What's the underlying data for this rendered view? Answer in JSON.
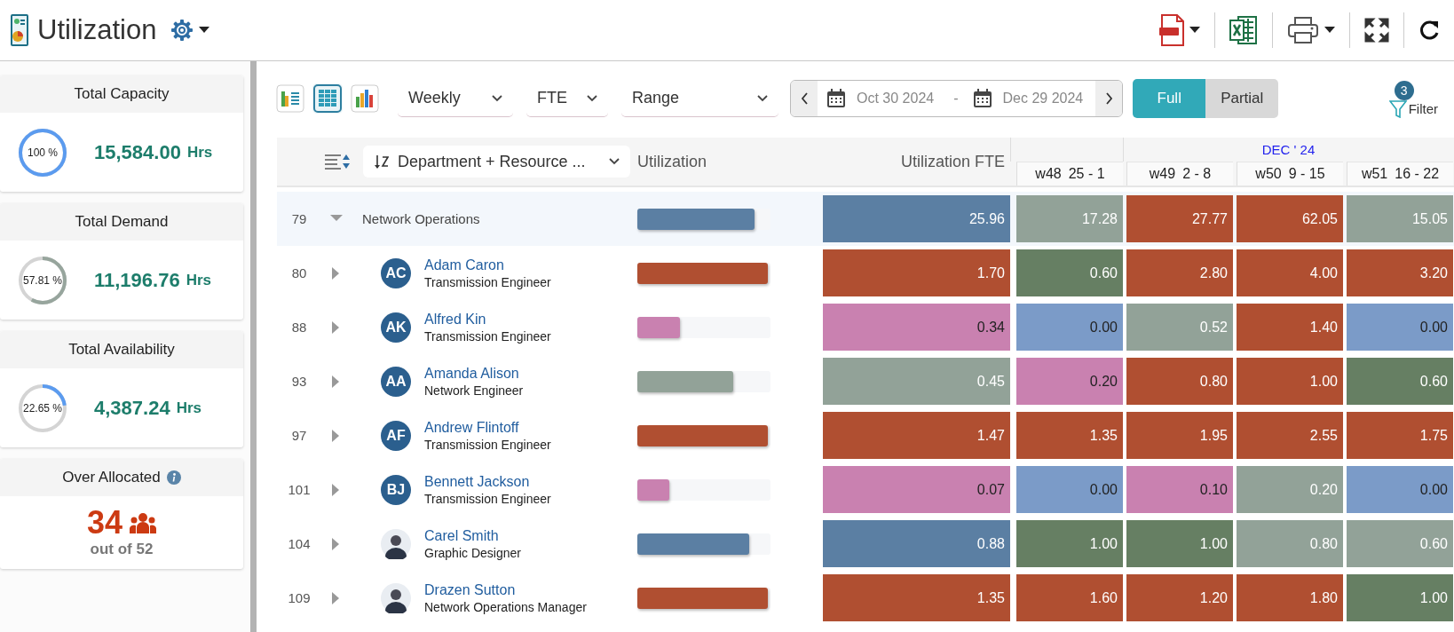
{
  "header": {
    "title": "Utilization"
  },
  "summary_cards": [
    {
      "kind": "ring",
      "title": "Total Capacity",
      "percent": "100 %",
      "level": 1,
      "color": "#5b9bef",
      "value": "15,584.00",
      "unit": "Hrs"
    },
    {
      "kind": "ring",
      "title": "Total Demand",
      "percent": "57.81 %",
      "level": 0.5781,
      "color": "#97a59d",
      "value": "11,196.76",
      "unit": "Hrs"
    },
    {
      "kind": "ring",
      "title": "Total Availability",
      "percent": "22.65 %",
      "level": 0.2265,
      "color": "#5b9bef",
      "value": "4,387.24",
      "unit": "Hrs"
    },
    {
      "kind": "count",
      "title": "Over Allocated",
      "value": "34",
      "subtext": "out of 52"
    }
  ],
  "toolbar": {
    "views": [
      {
        "kind": "stacked-list",
        "selected": false
      },
      {
        "kind": "table",
        "selected": true
      },
      {
        "kind": "bar-chart",
        "selected": false
      }
    ],
    "dropdowns": [
      "Weekly",
      "FTE",
      "Range"
    ],
    "date_from": "Oct 30 2024",
    "date_separator": "-",
    "date_to": "Dec 29 2024",
    "modes": [
      {
        "label": "Full",
        "selected": true
      },
      {
        "label": "Partial",
        "selected": false
      }
    ],
    "filter": {
      "label": "Filter",
      "badge": "3"
    }
  },
  "grid": {
    "group_by": "Department + Resource ...",
    "columns": [
      "Utilization",
      "Utilization FTE"
    ],
    "months": [
      {
        "weeks": [
          {
            "week": "w48",
            "range": "25 - 1"
          }
        ]
      },
      {
        "label": "DEC ' 24",
        "weeks": [
          {
            "week": "w49",
            "range": "2 - 8"
          },
          {
            "week": "w50",
            "range": "9 - 15"
          },
          {
            "week": "w51",
            "range": "16 - 22"
          }
        ]
      }
    ],
    "rows": [
      {
        "kind": "group",
        "number": "79",
        "expanded": true,
        "name": "Network Operations",
        "level": 0.88,
        "color": "#5b7fa3",
        "fte": "25.96",
        "weeks": [
          {
            "value": "17.28",
            "color": "#92a298"
          },
          {
            "value": "27.77",
            "color": "#b04f31"
          },
          {
            "value": "62.05",
            "color": "#b04f31"
          },
          {
            "value": "15.05",
            "color": "#92a298"
          }
        ]
      },
      {
        "kind": "person",
        "number": "80",
        "expanded": false,
        "avatar": {
          "kind": "initials",
          "initials": "AC"
        },
        "name": "Adam Caron",
        "role": "Transmission Engineer",
        "level": 0.98,
        "color": "#b04f31",
        "fte": "1.70",
        "weeks": [
          {
            "value": "0.60",
            "color": "#667f63"
          },
          {
            "value": "2.80",
            "color": "#b04f31"
          },
          {
            "value": "4.00",
            "color": "#b04f31"
          },
          {
            "value": "3.20",
            "color": "#b04f31"
          }
        ]
      },
      {
        "kind": "person",
        "number": "88",
        "expanded": false,
        "avatar": {
          "kind": "initials",
          "initials": "AK"
        },
        "name": "Alfred Kin",
        "role": "Transmission Engineer",
        "level": 0.32,
        "color": "#c981b0",
        "fte": "0.34",
        "weeks": [
          {
            "value": "0.00",
            "color": "#7b9bc8"
          },
          {
            "value": "0.52",
            "color": "#92a298"
          },
          {
            "value": "1.40",
            "color": "#b04f31"
          },
          {
            "value": "0.00",
            "color": "#7b9bc8"
          }
        ]
      },
      {
        "kind": "person",
        "number": "93",
        "expanded": false,
        "avatar": {
          "kind": "initials",
          "initials": "AA"
        },
        "name": "Amanda Alison",
        "role": "Network Engineer",
        "level": 0.72,
        "color": "#92a298",
        "fte": "0.45",
        "weeks": [
          {
            "value": "0.20",
            "color": "#c981b0"
          },
          {
            "value": "0.80",
            "color": "#b04f31"
          },
          {
            "value": "1.00",
            "color": "#b04f31"
          },
          {
            "value": "0.60",
            "color": "#667f63"
          }
        ]
      },
      {
        "kind": "person",
        "number": "97",
        "expanded": false,
        "avatar": {
          "kind": "initials",
          "initials": "AF"
        },
        "name": "Andrew Flintoff",
        "role": "Transmission Engineer",
        "level": 0.98,
        "color": "#b04f31",
        "fte": "1.47",
        "weeks": [
          {
            "value": "1.35",
            "color": "#b04f31"
          },
          {
            "value": "1.95",
            "color": "#b04f31"
          },
          {
            "value": "2.55",
            "color": "#b04f31"
          },
          {
            "value": "1.75",
            "color": "#b04f31"
          }
        ]
      },
      {
        "kind": "person",
        "number": "101",
        "expanded": false,
        "avatar": {
          "kind": "initials",
          "initials": "BJ"
        },
        "name": "Bennett Jackson",
        "role": "Transmission Engineer",
        "level": 0.24,
        "color": "#c981b0",
        "fte": "0.07",
        "weeks": [
          {
            "value": "0.00",
            "color": "#7b9bc8"
          },
          {
            "value": "0.10",
            "color": "#c981b0"
          },
          {
            "value": "0.20",
            "color": "#92a298"
          },
          {
            "value": "0.00",
            "color": "#7b9bc8"
          }
        ]
      },
      {
        "kind": "person",
        "number": "104",
        "expanded": false,
        "avatar": {
          "kind": "photo"
        },
        "name": "Carel Smith",
        "role": "Graphic Designer",
        "level": 0.84,
        "color": "#5b7fa3",
        "fte": "0.88",
        "weeks": [
          {
            "value": "1.00",
            "color": "#667f63"
          },
          {
            "value": "1.00",
            "color": "#667f63"
          },
          {
            "value": "0.80",
            "color": "#92a298"
          },
          {
            "value": "0.60",
            "color": "#92a298"
          }
        ]
      },
      {
        "kind": "person",
        "number": "109",
        "expanded": false,
        "avatar": {
          "kind": "photo"
        },
        "name": "Drazen Sutton",
        "role": "Network Operations Manager",
        "level": 0.98,
        "color": "#b04f31",
        "fte": "1.35",
        "weeks": [
          {
            "value": "1.60",
            "color": "#b04f31"
          },
          {
            "value": "1.20",
            "color": "#b04f31"
          },
          {
            "value": "1.80",
            "color": "#b04f31"
          },
          {
            "value": "1.00",
            "color": "#667f63"
          }
        ]
      }
    ]
  }
}
